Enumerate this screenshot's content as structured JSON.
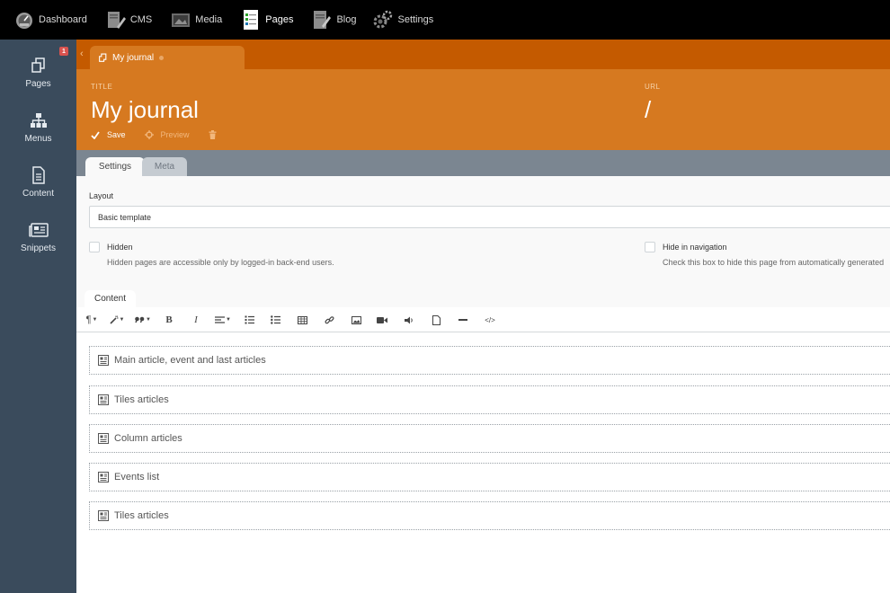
{
  "topnav": {
    "items": [
      {
        "label": "Dashboard",
        "icon": "dashboard-icon",
        "active": false
      },
      {
        "label": "CMS",
        "icon": "cms-icon",
        "active": false
      },
      {
        "label": "Media",
        "icon": "media-icon",
        "active": false
      },
      {
        "label": "Pages",
        "icon": "pages-icon",
        "active": true
      },
      {
        "label": "Blog",
        "icon": "blog-icon",
        "active": false
      },
      {
        "label": "Settings",
        "icon": "settings-icon",
        "active": false
      }
    ]
  },
  "sidebar": {
    "items": [
      {
        "label": "Pages",
        "icon": "pages-icon",
        "badge": "1"
      },
      {
        "label": "Menus",
        "icon": "sitemap-icon"
      },
      {
        "label": "Content",
        "icon": "document-icon"
      },
      {
        "label": "Snippets",
        "icon": "newspaper-icon"
      }
    ]
  },
  "editor": {
    "tab_title": "My journal",
    "title_label": "TITLE",
    "title_value": "My journal",
    "url_label": "URL",
    "url_value": "/",
    "actions": {
      "save": "Save",
      "preview": "Preview"
    }
  },
  "tabs": {
    "settings": "Settings",
    "meta": "Meta",
    "content": "Content"
  },
  "form": {
    "layout_label": "Layout",
    "layout_value": "Basic template",
    "hidden_label": "Hidden",
    "hidden_help": "Hidden pages are accessible only by logged-in back-end users.",
    "hide_nav_label": "Hide in navigation",
    "hide_nav_help": "Check this box to hide this page from automatically generated"
  },
  "blocks": [
    "Main article, event and last articles",
    "Tiles articles",
    "Column articles",
    "Events list",
    "Tiles articles"
  ],
  "colors": {
    "topbar": "#000000",
    "sidebar": "#3a4b5c",
    "accent_dark": "#c45a00",
    "accent": "#d67920",
    "tabstrip": "#7b8691"
  }
}
